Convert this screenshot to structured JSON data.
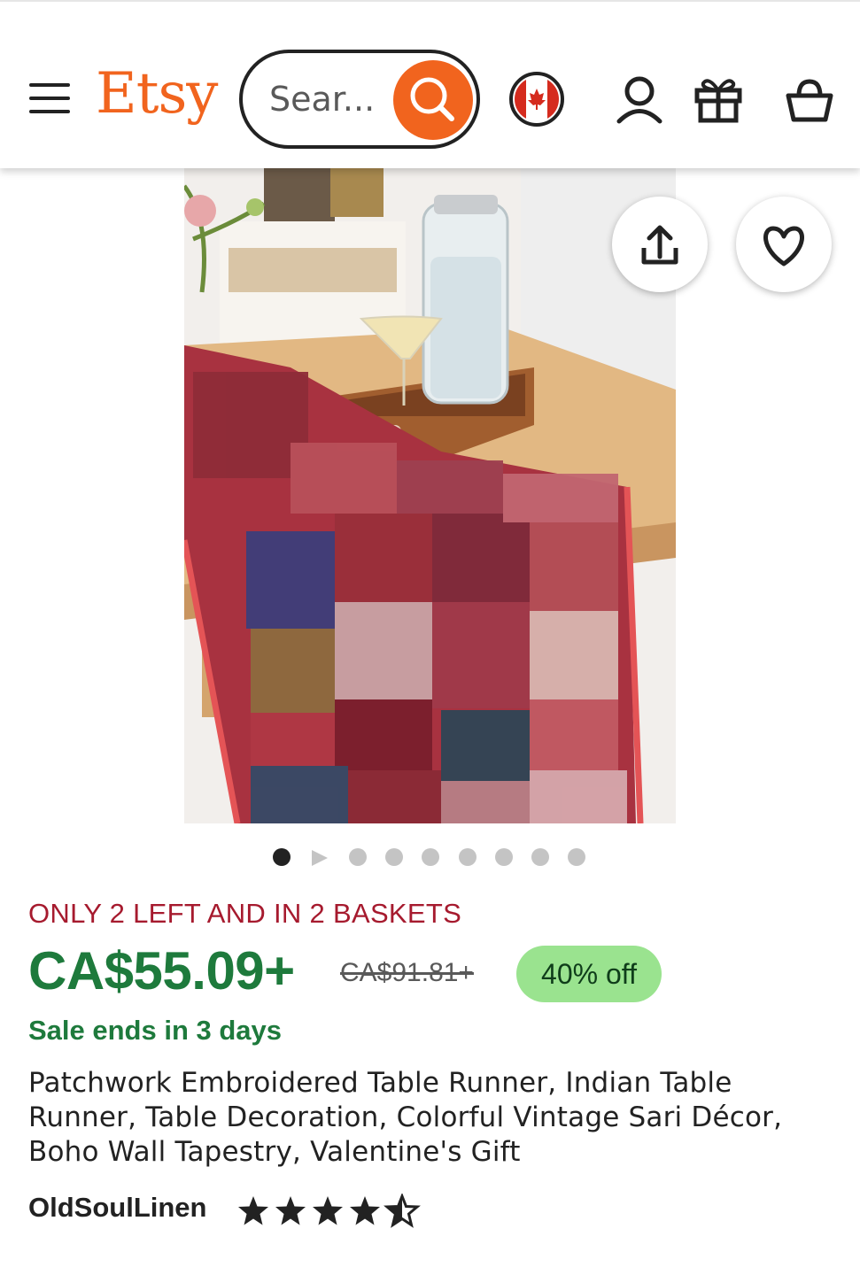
{
  "header": {
    "logo": "Etsy",
    "search_placeholder": "Sear...",
    "region_flag": "canada-flag"
  },
  "icons": {
    "menu": "menu-icon",
    "search": "search-icon",
    "account": "user-icon",
    "gifts": "gift-icon",
    "cart": "basket-icon",
    "share": "share-icon",
    "favorite": "heart-icon"
  },
  "gallery": {
    "image_count": 9,
    "active_index": 0,
    "video_index": 1
  },
  "product": {
    "stock_notice": "ONLY 2 LEFT AND IN 2 BASKETS",
    "price": "CA$55.09+",
    "original_price": "CA$91.81+",
    "discount": "40% off",
    "sale_ends": "Sale ends in 3 days",
    "title": "Patchwork Embroidered Table Runner, Indian Table Runner, Table Decoration, Colorful Vintage Sari Décor, Boho Wall Tapestry, Valentine's Gift",
    "shop_name": "OldSoulLinen",
    "rating": 4.5
  },
  "colors": {
    "brand": "#f1641e",
    "price_green": "#1e7a3c",
    "stock_red": "#a61a2e",
    "discount_bg": "#9ae38f"
  }
}
